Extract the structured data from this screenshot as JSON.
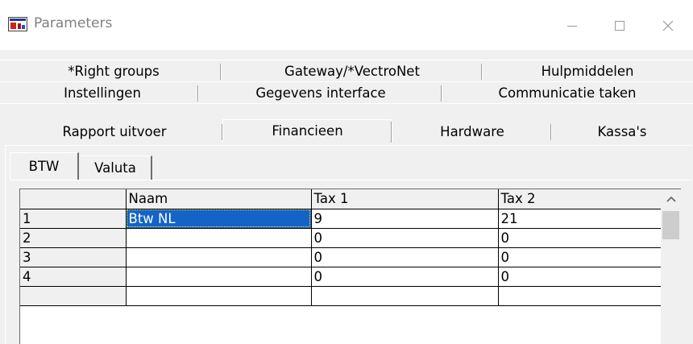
{
  "window": {
    "title": "Parameters",
    "controls": {
      "minimize": "minimize-icon",
      "maximize": "maximize-icon",
      "close": "close-icon"
    }
  },
  "tabs": {
    "row1": [
      "*Right groups",
      "Gateway/*VectroNet",
      "Hulpmiddelen"
    ],
    "row2": [
      "Instellingen",
      "Gegevens interface",
      "Communicatie taken"
    ],
    "row3": [
      "Rapport uitvoer",
      "Financieen",
      "Hardware",
      "Kassa's"
    ],
    "active": "Financieen"
  },
  "subtabs": {
    "items": [
      "BTW",
      "Valuta"
    ],
    "active": "BTW"
  },
  "grid": {
    "columns": [
      "",
      "Naam",
      "Tax 1",
      "Tax 2"
    ],
    "rows": [
      [
        "1",
        "Btw NL",
        "9",
        "21"
      ],
      [
        "2",
        "",
        "0",
        "0"
      ],
      [
        "3",
        "",
        "0",
        "0"
      ],
      [
        "4",
        "",
        "0",
        "0"
      ]
    ],
    "selected_cell": "Btw NL"
  },
  "colors": {
    "selection": "#1464c8",
    "window_bg": "#f0f0f0",
    "title_text": "#808080"
  }
}
